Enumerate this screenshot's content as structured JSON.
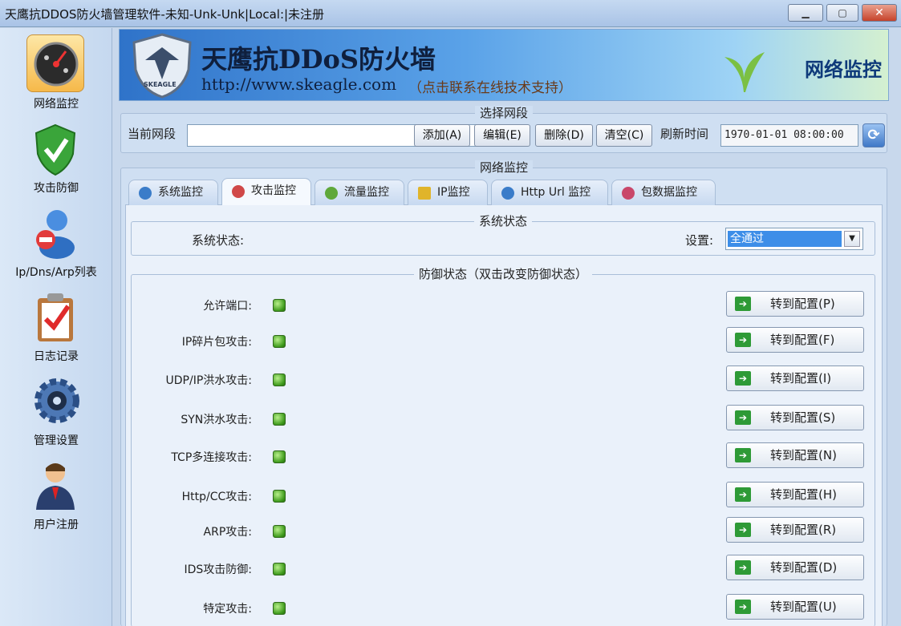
{
  "window": {
    "title": "天鹰抗DDOS防火墙管理软件-未知-Unk-Unk|Local:|未注册",
    "min_icon": "minimize-icon",
    "max_icon": "maximize-icon",
    "close_icon": "close-icon"
  },
  "sidebar": {
    "items": [
      {
        "label": "网络监控",
        "icon": "dashboard-gauge-icon",
        "active": true
      },
      {
        "label": "攻击防御",
        "icon": "shield-check-icon",
        "active": false
      },
      {
        "label": "Ip/Dns/Arp列表",
        "icon": "user-block-icon",
        "active": false
      },
      {
        "label": "日志记录",
        "icon": "clipboard-check-icon",
        "active": false
      },
      {
        "label": "管理设置",
        "icon": "gear-icon",
        "active": false
      },
      {
        "label": "用户注册",
        "icon": "user-person-icon",
        "active": false
      }
    ]
  },
  "banner": {
    "product_name": "天鹰抗DDoS防火墙",
    "url": "http://www.skeagle.com",
    "support_text": "（点击联系在线技术支持）",
    "logo_text": "SKEAGLE",
    "corner_title": "网络监控"
  },
  "segment": {
    "group_title": "选择网段",
    "current_label": "当前网段",
    "current_value": "",
    "add_label": "添加(A)",
    "edit_label": "编辑(E)",
    "delete_label": "删除(D)",
    "clear_label": "清空(C)",
    "refresh_label": "刷新时间",
    "refresh_time": "1970-01-01 08:00:00"
  },
  "monitor": {
    "group_title": "网络监控",
    "tabs": [
      {
        "label": "系统监控",
        "icon": "globe-icon"
      },
      {
        "label": "攻击监控",
        "icon": "attack-icon",
        "active": true
      },
      {
        "label": "流量监控",
        "icon": "traffic-icon"
      },
      {
        "label": "IP监控",
        "icon": "folder-icon"
      },
      {
        "label": "Http Url 监控",
        "icon": "globe-icon"
      },
      {
        "label": "包数据监控",
        "icon": "packet-icon"
      }
    ]
  },
  "system_status": {
    "group_title": "系统状态",
    "label": "系统状态:",
    "setting_label": "设置:",
    "setting_value": "全通过"
  },
  "defense": {
    "group_title": "防御状态（双击改变防御状态）",
    "rows": [
      {
        "label": "允许端口:",
        "button": "转到配置(P)",
        "status": "on"
      },
      {
        "label": "IP碎片包攻击:",
        "button": "转到配置(F)",
        "status": "on"
      },
      {
        "label": "UDP/IP洪水攻击:",
        "button": "转到配置(I)",
        "status": "on"
      },
      {
        "label": "SYN洪水攻击:",
        "button": "转到配置(S)",
        "status": "on"
      },
      {
        "label": "TCP多连接攻击:",
        "button": "转到配置(N)",
        "status": "on"
      },
      {
        "label": "Http/CC攻击:",
        "button": "转到配置(H)",
        "status": "on"
      },
      {
        "label": "ARP攻击:",
        "button": "转到配置(R)",
        "status": "on"
      },
      {
        "label": "IDS攻击防御:",
        "button": "转到配置(D)",
        "status": "on"
      },
      {
        "label": "特定攻击:",
        "button": "转到配置(U)",
        "status": "on"
      }
    ]
  },
  "colors": {
    "led_on": "#3e9a1c",
    "accent": "#3d8ee8",
    "close_button": "#c6432b"
  }
}
